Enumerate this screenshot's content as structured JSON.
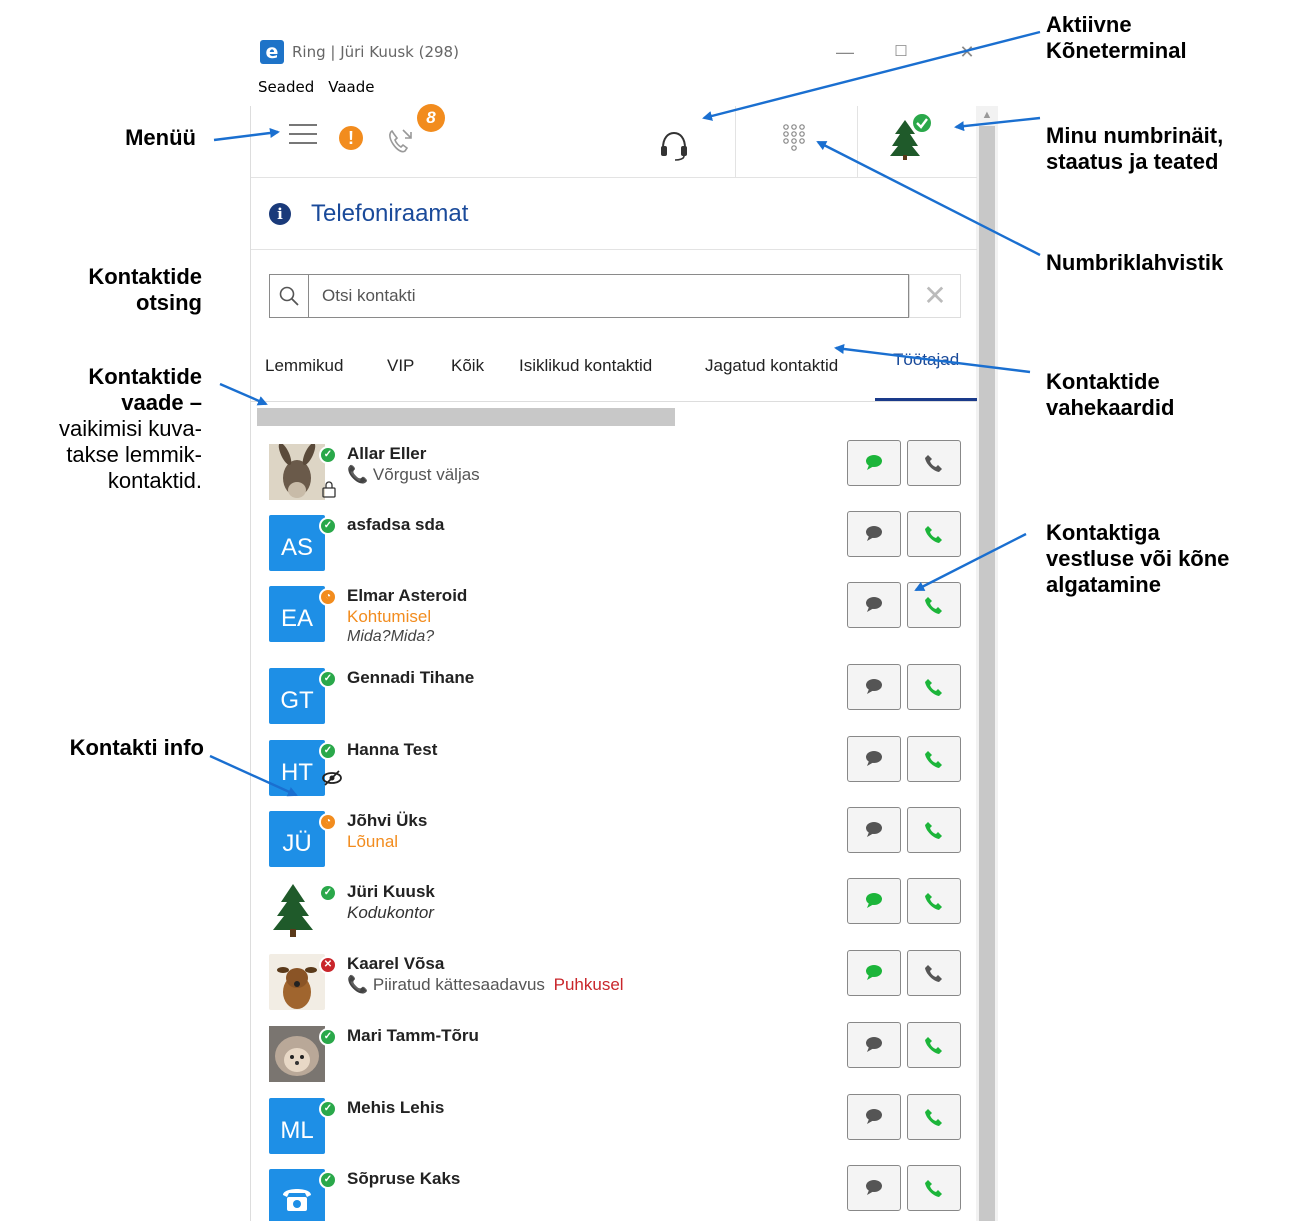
{
  "window": {
    "title": "Ring | Jüri Kuusk (298)",
    "logo_letter": "e",
    "controls": [
      "—",
      "☐",
      "✕"
    ],
    "menu": [
      "Seaded",
      "Vaade"
    ]
  },
  "toolbar": {
    "alert_glyph": "!",
    "missed_calls_badge": "8",
    "icons": [
      "hamburger-icon",
      "alert-icon",
      "missed-calls-icon",
      "headset-icon",
      "dialpad-icon",
      "profile-avatar"
    ]
  },
  "section": {
    "info_glyph": "i",
    "title": "Telefoniraamat"
  },
  "search": {
    "placeholder": "Otsi kontakti",
    "clear_glyph": "✕"
  },
  "tabs": [
    "Lemmikud",
    "VIP",
    "Kõik",
    "Isiklikud kontaktid",
    "Jagatud kontaktid",
    "Töötajad"
  ],
  "active_tab": "Töötajad",
  "contacts": [
    {
      "name": "Allar Eller",
      "avatar": "photo-donkey",
      "status": "available",
      "line2": "Võrgust väljas",
      "line2_icon": "phone-icon",
      "extra": "lock-icon",
      "chat_active": true,
      "call_active": false
    },
    {
      "name": "asfadsa sda",
      "initials": "AS",
      "status": "available",
      "chat_active": false,
      "call_active": true
    },
    {
      "name": "Elmar Asteroid",
      "initials": "EA",
      "status": "away",
      "line2": "Kohtumisel",
      "line3": "Mida?Mida?",
      "chat_active": false,
      "call_active": true
    },
    {
      "name": "Gennadi Tihane",
      "initials": "GT",
      "status": "available",
      "chat_active": false,
      "call_active": true
    },
    {
      "name": "Hanna Test",
      "initials": "HT",
      "status": "available",
      "extra": "eye-slash-icon",
      "chat_active": false,
      "call_active": true
    },
    {
      "name": "Jõhvi Üks",
      "initials": "JÜ",
      "status": "away",
      "line2": "Lõunal",
      "chat_active": false,
      "call_active": true
    },
    {
      "name": "Jüri Kuusk",
      "avatar": "photo-tree",
      "status": "available",
      "line2": "Kodukontor",
      "chat_active": true,
      "call_active": true
    },
    {
      "name": "Kaarel Võsa",
      "avatar": "photo-dog",
      "status": "busy",
      "line2": "Piiratud kättesaadavus",
      "line2_icon": "phone-icon",
      "line2_extra": "Puhkusel",
      "chat_active": true,
      "call_active": false
    },
    {
      "name": "Mari Tamm-Tõru",
      "avatar": "photo-hedgehog",
      "status": "available",
      "chat_active": false,
      "call_active": true
    },
    {
      "name": "Mehis Lehis",
      "initials": "ML",
      "status": "available",
      "chat_active": false,
      "call_active": true
    },
    {
      "name": "Sõpruse Kaks",
      "avatar": "phone-tile",
      "status": "available",
      "chat_active": false,
      "call_active": true
    }
  ],
  "annotations": {
    "menu": "Menüü",
    "terminal_1": "Aktiivne",
    "terminal_2": "Kõneterminal",
    "mine_1": "Minu numbrinäit,",
    "mine_2": "staatus ja teated",
    "dialpad": "Numbriklahvistik",
    "search_1": "Kontaktide",
    "search_2": "otsing",
    "view_1": "Kontaktide",
    "view_2": "vaade –",
    "view_3": "vaikimisi kuva-",
    "view_4": "takse lemmik-",
    "view_5": "kontaktid.",
    "tabs_1": "Kontaktide",
    "tabs_2": "vahekaardid",
    "action_1": "Kontaktiga",
    "action_2": "vestluse või kõne",
    "action_3": "algatamine",
    "info": "Kontakti info"
  },
  "colors": {
    "accent": "#1a4a9a",
    "available": "#2aa84a",
    "away": "#f28c1e",
    "busy": "#c9262b",
    "arrow": "#1a6fd0"
  }
}
